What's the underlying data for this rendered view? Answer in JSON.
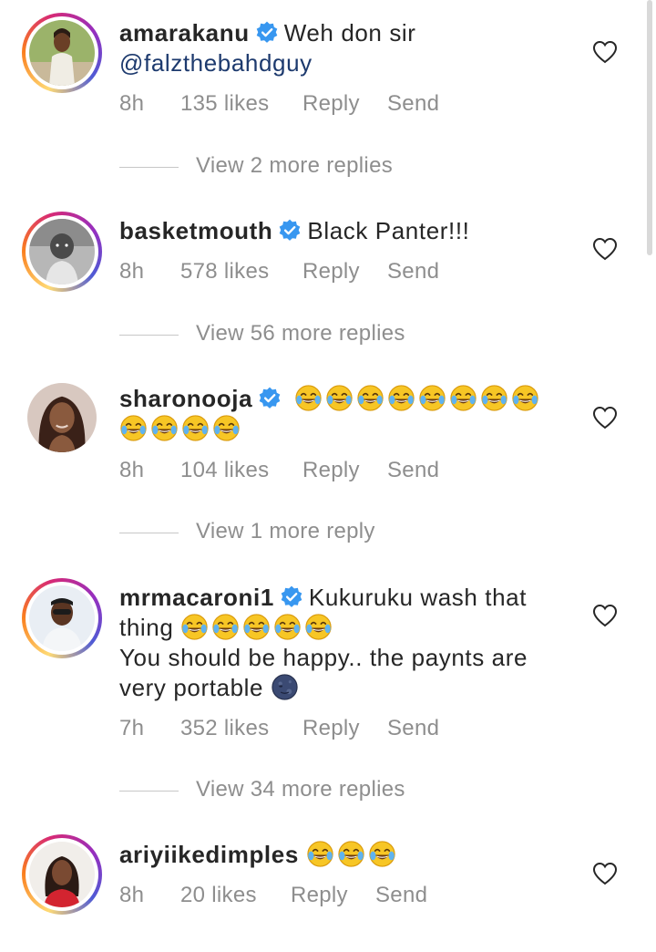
{
  "comments": [
    {
      "username": "amarakanu",
      "text": "Weh don sir",
      "mention": "@falzthebahdguy",
      "time": "8h",
      "likes": "135 likes",
      "reply": "Reply",
      "send": "Send",
      "view_replies": "View 2 more replies"
    },
    {
      "username": "basketmouth",
      "text": "Black Panter!!!",
      "time": "8h",
      "likes": "578 likes",
      "reply": "Reply",
      "send": "Send",
      "view_replies": "View 56 more replies"
    },
    {
      "username": "sharonooja",
      "emoji_count": 12,
      "time": "8h",
      "likes": "104 likes",
      "reply": "Reply",
      "send": "Send",
      "view_replies": "View 1 more reply"
    },
    {
      "username": "mrmacaroni1",
      "text_line1": "Kukuruku wash that",
      "text_line2": "thing",
      "text_line3": "You should be happy.. the paynts are",
      "text_line4": "very portable",
      "time": "7h",
      "likes": "352 likes",
      "reply": "Reply",
      "send": "Send",
      "view_replies": "View 34 more replies"
    },
    {
      "username": "ariyiikedimples",
      "time": "8h",
      "likes": "20 likes",
      "reply": "Reply",
      "send": "Send"
    }
  ],
  "icons": {
    "verified": "verified-badge-icon",
    "heart": "heart-outline-icon",
    "emoji_laugh": "face-with-tears-of-joy-emoji",
    "emoji_moon": "new-moon-face-emoji"
  },
  "colors": {
    "verified_blue": "#3897f0",
    "meta_gray": "#8e8e8e",
    "mention_blue": "#1d3a6e"
  }
}
